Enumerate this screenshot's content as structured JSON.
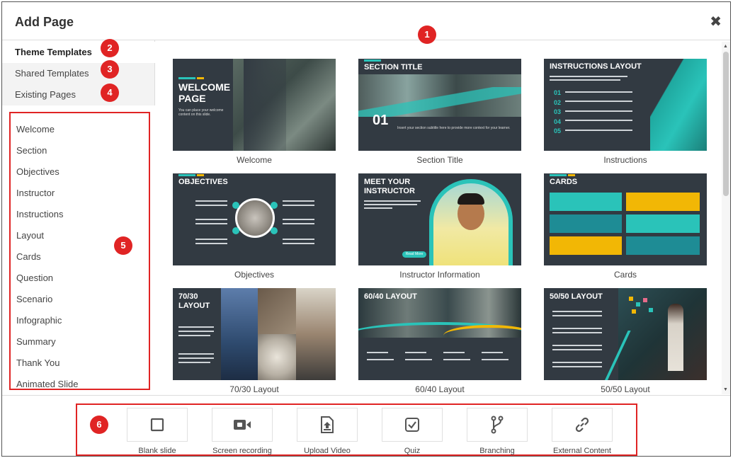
{
  "dialog": {
    "title": "Add Page",
    "close_glyph": "✖"
  },
  "badges": [
    "1",
    "2",
    "3",
    "4",
    "5",
    "6"
  ],
  "tabs": [
    {
      "label": "Theme Templates"
    },
    {
      "label": "Shared Templates"
    },
    {
      "label": "Existing Pages"
    }
  ],
  "categories": [
    "Welcome",
    "Section",
    "Objectives",
    "Instructor",
    "Instructions",
    "Layout",
    "Cards",
    "Question",
    "Scenario",
    "Infographic",
    "Summary",
    "Thank You",
    "Animated Slide"
  ],
  "templates": [
    {
      "label": "Welcome",
      "thumb_title": "WELCOME PAGE",
      "thumb_sub": "You can place your welcome content on this slide."
    },
    {
      "label": "Section Title",
      "thumb_title": "SECTION TITLE",
      "thumb_num": "01",
      "thumb_sub": "Insert your section subtitle here to provide more context for your learner."
    },
    {
      "label": "Instructions",
      "thumb_title": "INSTRUCTIONS LAYOUT",
      "thumb_nums": [
        "01",
        "02",
        "03",
        "04",
        "05"
      ]
    },
    {
      "label": "Objectives",
      "thumb_title": "OBJECTIVES"
    },
    {
      "label": "Instructor Information",
      "thumb_title": "MEET YOUR INSTRUCTOR",
      "thumb_btn": "Read More"
    },
    {
      "label": "Cards",
      "thumb_title": "CARDS"
    },
    {
      "label": "70/30 Layout",
      "thumb_title": "70/30 LAYOUT"
    },
    {
      "label": "60/40 Layout",
      "thumb_title": "60/40 LAYOUT"
    },
    {
      "label": "50/50 Layout",
      "thumb_title": "50/50 LAYOUT"
    }
  ],
  "tools": [
    {
      "label": "Blank slide",
      "icon": "square-icon"
    },
    {
      "label": "Screen recording",
      "icon": "video-camera-icon"
    },
    {
      "label": "Upload Video",
      "icon": "upload-file-icon"
    },
    {
      "label": "Quiz",
      "icon": "checkbox-icon"
    },
    {
      "label": "Branching",
      "icon": "branch-icon"
    },
    {
      "label": "External Content",
      "icon": "link-icon"
    }
  ],
  "colors": {
    "badge": "#e02424",
    "slide_bg": "#323a42",
    "teal": "#2ac3b9",
    "yellow": "#f2b705"
  }
}
